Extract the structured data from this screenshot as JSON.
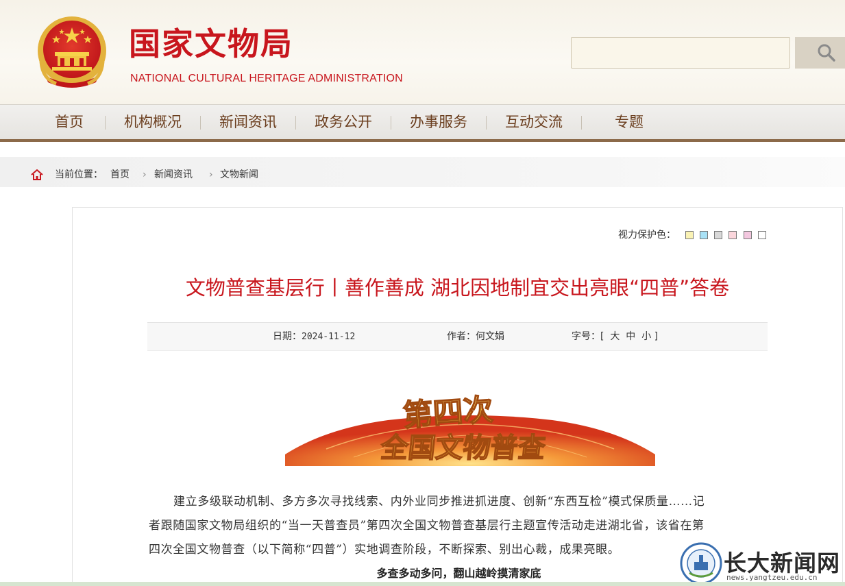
{
  "header": {
    "title": "国家文物局",
    "subtitle": "NATIONAL  CULTURAL HERITAGE ADMINISTRATION",
    "search_placeholder": ""
  },
  "nav": {
    "items": [
      {
        "label": "首页"
      },
      {
        "label": "机构概况"
      },
      {
        "label": "新闻资讯"
      },
      {
        "label": "政务公开"
      },
      {
        "label": "办事服务"
      },
      {
        "label": "互动交流"
      },
      {
        "label": "专题"
      }
    ]
  },
  "breadcrumb": {
    "prefix": "当前位置：",
    "items": [
      "首页",
      "新闻资讯",
      "文物新闻"
    ]
  },
  "eye_protection": {
    "label": "视力保护色：",
    "colors": [
      "#faf2b4",
      "#a8e1f6",
      "#d8d8d8",
      "#fbd6dc",
      "#f3c7df",
      "#ffffff"
    ]
  },
  "article": {
    "title": "文物普查基层行丨善作善成 湖北因地制宜交出亮眼“四普”答卷",
    "date_label": "日期：",
    "date": "2024-11-12",
    "author_label": "作者：",
    "author": "何文娟",
    "font_label": "字号：",
    "font_open": "[",
    "font_sizes": [
      "大",
      "中",
      "小"
    ],
    "font_close": "]",
    "banner_line1": "第四次",
    "banner_line2": "全国文物普查",
    "para1_line1": "建立多级联动机制、多方多次寻找线索、内外业同步推进抓进度、创新“东西互检”模式保质量……记",
    "para1_line2": "者跟随国家文物局组织的“当一天普查员”第四次全国文物普查基层行主题宣传活动走进湖北省，该省在第",
    "para1_line3": "四次全国文物普查（以下简称“四普”）实地调查阶段，不断探索、别出心裁，成果亮眼。",
    "subheading": "多查多动多问，翻山越岭摸清家底"
  },
  "watermark": {
    "text": "长大新闻网",
    "url": "news.yangtzeu.edu.cn"
  }
}
